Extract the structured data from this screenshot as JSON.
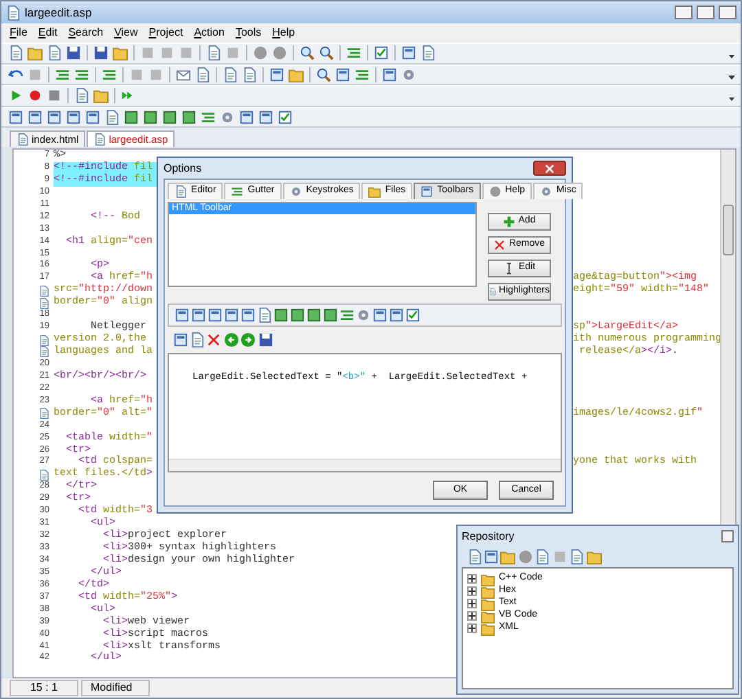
{
  "window": {
    "title": "largeedit.asp"
  },
  "menu": [
    "File",
    "Edit",
    "Search",
    "View",
    "Project",
    "Action",
    "Tools",
    "Help"
  ],
  "doc_tabs": [
    {
      "label": "index.html",
      "selected": false
    },
    {
      "label": "largeedit.asp",
      "selected": true
    }
  ],
  "editor": {
    "lines": [
      {
        "kind": "line",
        "number": "7",
        "text": "%>",
        "selected": false
      },
      {
        "kind": "line",
        "number": "8",
        "text": "<!--#include fil",
        "selected": true
      },
      {
        "kind": "line",
        "number": "9",
        "text": "<!--#include fil",
        "selected": true
      },
      {
        "kind": "line",
        "number": "10",
        "selected": false
      },
      {
        "kind": "line",
        "number": "11",
        "selected": false
      },
      {
        "kind": "line",
        "number": "12",
        "text": "      <!-- Bod",
        "selected": false
      },
      {
        "kind": "line",
        "number": "13",
        "selected": false
      },
      {
        "kind": "line",
        "number": "14",
        "text": "  <h1 align=\"cen",
        "selected": false
      },
      {
        "kind": "line",
        "number": "15",
        "selected": false
      },
      {
        "kind": "line",
        "number": "16",
        "text": "      <p>",
        "selected": false
      },
      {
        "kind": "line",
        "number": "17",
        "text": "      <a href=\"h",
        "tail": "age&tag=button\"><img",
        "selected": false
      },
      {
        "kind": "wrap",
        "text": "src=\"http://down",
        "tail": "eight=\"59\" width=\"148\"",
        "selected": false
      },
      {
        "kind": "wrap",
        "text": "border=\"0\" align",
        "selected": false
      },
      {
        "kind": "line",
        "number": "18",
        "selected": false
      },
      {
        "kind": "line",
        "number": "19",
        "text": "      Netlegger ",
        "tail": "sp\">LargeEdit</a>",
        "selected": false
      },
      {
        "kind": "wrap",
        "text": "version 2.0,the ",
        "tail": "ith numerous programming",
        "selected": false
      },
      {
        "kind": "wrap",
        "text": "languages and la",
        "tail": " release</a></i>.",
        "selected": false
      },
      {
        "kind": "line",
        "number": "20",
        "selected": false
      },
      {
        "kind": "line",
        "number": "21",
        "text": "<br/><br/><br/>",
        "selected": false
      },
      {
        "kind": "line",
        "number": "22",
        "selected": false
      },
      {
        "kind": "line",
        "number": "23",
        "text": "      <a href=\"h",
        "selected": false
      },
      {
        "kind": "wrap",
        "text": "border=\"0\" alt=\"",
        "tail": "images/le/4cows2.gif\"",
        "selected": false
      },
      {
        "kind": "line",
        "number": "24",
        "selected": false
      },
      {
        "kind": "line",
        "number": "25",
        "text": "  <table width=\"",
        "selected": false
      },
      {
        "kind": "line",
        "number": "26",
        "text": "  <tr>",
        "selected": false
      },
      {
        "kind": "line",
        "number": "27",
        "text": "    <td colspan=",
        "tail": "yone that works with",
        "selected": false
      },
      {
        "kind": "wrap",
        "text": "text files.</td>",
        "selected": false
      },
      {
        "kind": "line",
        "number": "28",
        "text": "  </tr>",
        "selected": false
      },
      {
        "kind": "line",
        "number": "29",
        "text": "  <tr>",
        "selected": false
      },
      {
        "kind": "line",
        "number": "30",
        "text": "    <td width=\"3",
        "selected": false
      },
      {
        "kind": "line",
        "number": "31",
        "text": "      <ul>",
        "selected": false
      },
      {
        "kind": "line",
        "number": "32",
        "text": "        <li>project explorer",
        "selected": false
      },
      {
        "kind": "line",
        "number": "33",
        "text": "        <li>300+ syntax highlighters",
        "selected": false
      },
      {
        "kind": "line",
        "number": "34",
        "text": "        <li>design your own highlighter",
        "selected": false
      },
      {
        "kind": "line",
        "number": "35",
        "text": "      </ul>",
        "selected": false
      },
      {
        "kind": "line",
        "number": "36",
        "text": "    </td>",
        "selected": false
      },
      {
        "kind": "line",
        "number": "37",
        "text": "    <td width=\"25%\">",
        "selected": false
      },
      {
        "kind": "line",
        "number": "38",
        "text": "      <ul>",
        "selected": false
      },
      {
        "kind": "line",
        "number": "39",
        "text": "        <li>web viewer",
        "selected": false
      },
      {
        "kind": "line",
        "number": "40",
        "text": "        <li>script macros",
        "selected": false
      },
      {
        "kind": "line",
        "number": "41",
        "text": "        <li>xslt transforms",
        "selected": false
      },
      {
        "kind": "line",
        "number": "42",
        "text": "      </ul>",
        "selected": false
      }
    ]
  },
  "options_dialog": {
    "title": "Options",
    "tabs": [
      {
        "label": "Editor",
        "selected": false
      },
      {
        "label": "Gutter",
        "selected": false
      },
      {
        "label": "Keystrokes",
        "selected": false
      },
      {
        "label": "Files",
        "selected": false
      },
      {
        "label": "Toolbars",
        "selected": true
      },
      {
        "label": "Help",
        "selected": false
      },
      {
        "label": "Misc",
        "selected": false
      }
    ],
    "toolbar_list": [
      {
        "label": "HTML Toolbar",
        "selected": true
      }
    ],
    "buttons": [
      "Add",
      "Remove",
      "Edit",
      "Highlighters"
    ],
    "script_text": "LargeEdit.SelectedText = \"<b>\" +  LargeEdit.SelectedText +",
    "footer_buttons": [
      "OK",
      "Cancel"
    ]
  },
  "repository": {
    "title": "Repository",
    "items": [
      {
        "label": "C++ Code",
        "expanded": false
      },
      {
        "label": "Hex",
        "expanded": false
      },
      {
        "label": "Text",
        "expanded": false
      },
      {
        "label": "VB Code",
        "expanded": false
      },
      {
        "label": "XML",
        "expanded": false
      }
    ]
  },
  "status_bar": {
    "position": "15 : 1",
    "state": "Modified"
  }
}
